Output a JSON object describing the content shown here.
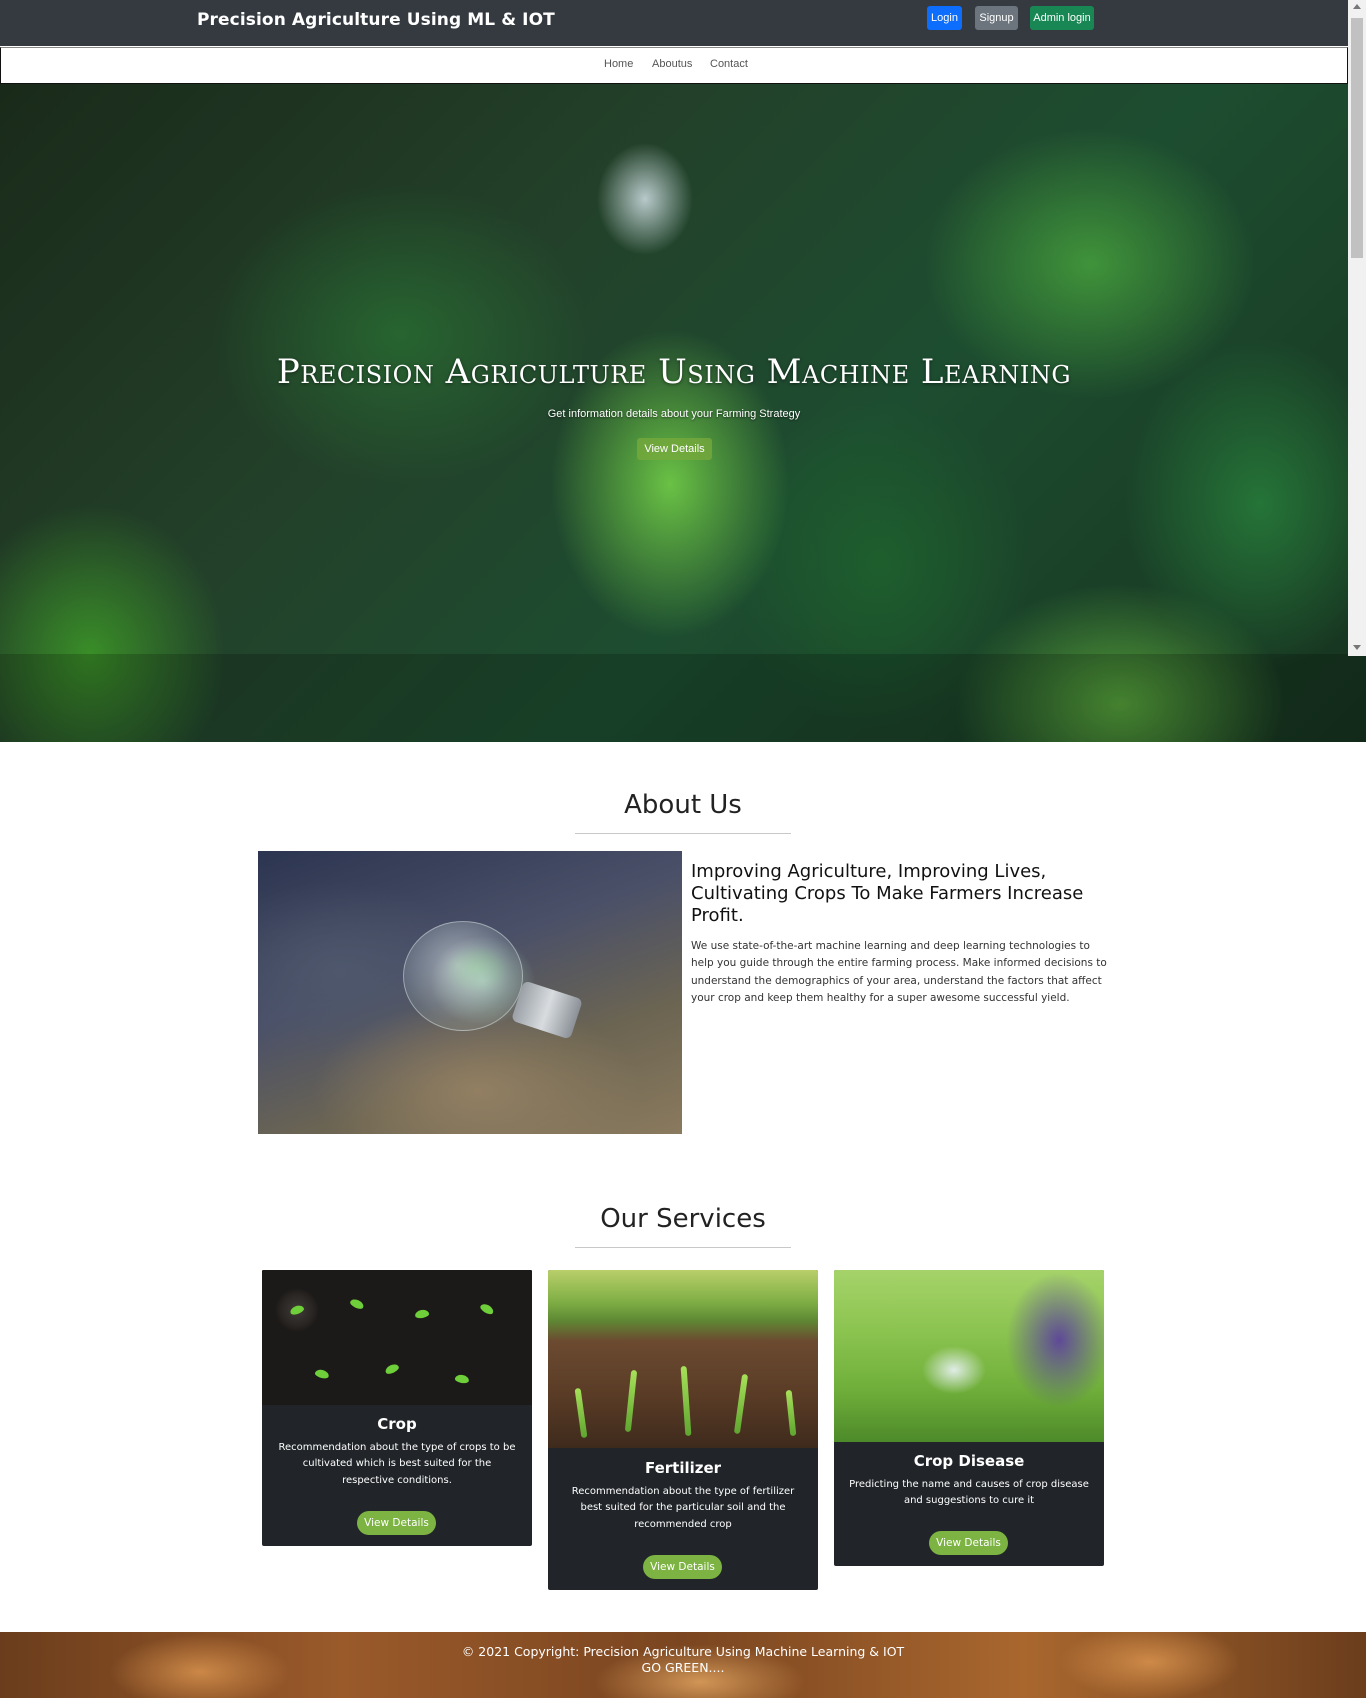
{
  "navbar": {
    "brand": "Precision Agriculture Using ML & IOT",
    "login_label": "Login",
    "signup_label": "Signup",
    "admin_login_label": "Admin login"
  },
  "subnav": {
    "items": [
      "Home",
      "Aboutus",
      "Contact"
    ]
  },
  "hero": {
    "title": "Precision Agriculture Using Machine Learning",
    "subtitle": "Get information details about your Farming Strategy",
    "button_label": "View Details"
  },
  "about": {
    "title": "About Us",
    "heading": "Improving Agriculture, Improving Lives, Cultivating Crops To Make Farmers Increase Profit.",
    "text": "We use state-of-the-art machine learning and deep learning technologies to help you guide through the entire farming process. Make informed decisions to understand the demographics of your area, understand the factors that affect your crop and keep them healthy for a super awesome successful yield."
  },
  "services": {
    "title": "Our Services",
    "cards": [
      {
        "title": "Crop",
        "text": "Recommendation about the type of crops to be cultivated which is best suited for the respective conditions.",
        "button_label": "View Details"
      },
      {
        "title": "Fertilizer",
        "text": "Recommendation about the type of fertilizer best suited for the particular soil and the recommended crop",
        "button_label": "View Details"
      },
      {
        "title": "Crop Disease",
        "text": "Predicting the name and causes of crop disease and suggestions to cure it",
        "button_label": "View Details"
      }
    ]
  },
  "footer": {
    "copyright": "© 2021 Copyright: Precision Agriculture Using Machine Learning & IOT",
    "tagline": "GO GREEN...."
  },
  "colors": {
    "navbar_bg": "#343a40",
    "login_btn": "#0d6efd",
    "signup_btn": "#6c757d",
    "admin_btn": "#198754",
    "card_bg": "#212529",
    "card_button": "#7cb342"
  }
}
